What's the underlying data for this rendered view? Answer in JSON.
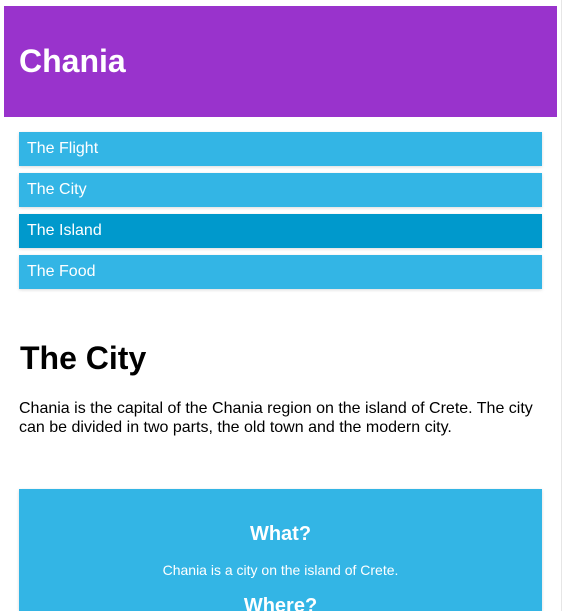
{
  "header": {
    "title": "Chania"
  },
  "menu": {
    "items": [
      {
        "label": "The Flight"
      },
      {
        "label": "The City"
      },
      {
        "label": "The Island"
      },
      {
        "label": "The Food"
      }
    ]
  },
  "main": {
    "heading": "The City",
    "paragraph": "Chania is the capital of the Chania region on the island of Crete. The city can be divided in two parts, the old town and the modern city."
  },
  "aside": {
    "what_heading": "What?",
    "what_text": "Chania is a city on the island of Crete.",
    "where_heading": "Where?"
  },
  "colors": {
    "header_bg": "#9933cc",
    "menu_bg": "#33b5e5",
    "menu_active_bg": "#0099cc"
  }
}
